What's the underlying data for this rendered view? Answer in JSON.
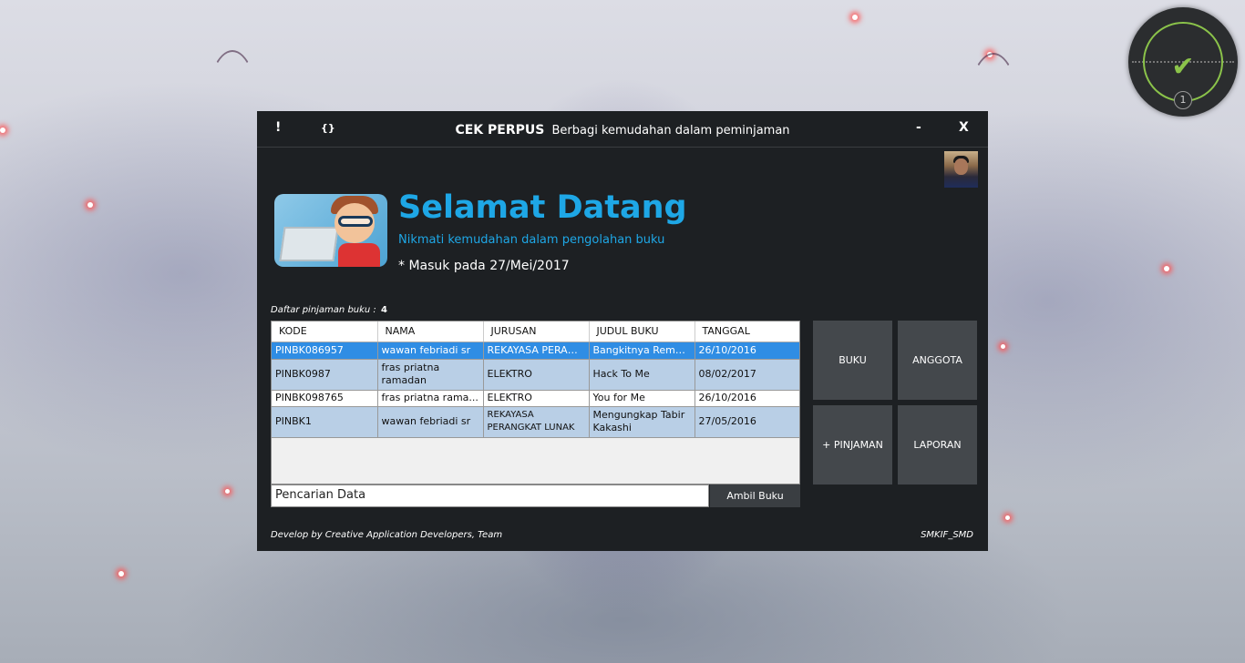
{
  "titlebar": {
    "info_button": "!",
    "code_button": "{}",
    "app_name": "CEK PERPUS",
    "tagline": "Berbagi kemudahan dalam peminjaman",
    "minimize": "-",
    "close": "X"
  },
  "welcome": {
    "title": "Selamat Datang",
    "subtitle": "Nikmati kemudahan dalam pengolahan buku",
    "login_info": "* Masuk pada 27/Mei/2017"
  },
  "loans": {
    "label": "Daftar pinjaman buku :",
    "count": "4",
    "columns": [
      "KODE",
      "NAMA",
      "JURUSAN",
      "JUDUL BUKU",
      "TANGGAL"
    ],
    "rows": [
      [
        "PINBK086957",
        "wawan febriadi sr",
        "REKAYASA PERANG...",
        "Bangkitnya Remo...",
        "26/10/2016"
      ],
      [
        "PINBK0987",
        "fras priatna ramadan",
        "ELEKTRO",
        "Hack To Me",
        "08/02/2017"
      ],
      [
        "PINBK098765",
        "fras priatna rama...",
        "ELEKTRO",
        "You for Me",
        "26/10/2016"
      ],
      [
        "PINBK1",
        "wawan febriadi sr",
        "REKAYASA PERANGKAT LUNAK",
        "Mengungkap Tabir Kakashi",
        "27/05/2016"
      ]
    ]
  },
  "search": {
    "value": "Pencarian Data"
  },
  "actions": {
    "ambil_buku": "Ambil Buku",
    "buku": "BUKU",
    "anggota": "ANGGOTA",
    "pinjaman": "+ PINJAMAN",
    "laporan": "LAPORAN"
  },
  "footer": {
    "credit": "Develop by Creative Application Developers, Team",
    "school": "SMKIF_SMD"
  },
  "widget": {
    "count": "1",
    "icon": "checkmark-icon"
  },
  "colors": {
    "accent": "#1ea7e6",
    "window_bg": "#1d2023",
    "tile_bg": "#44484c",
    "row_alt": "#b9cfe6",
    "row_selected": "#2f8de4"
  }
}
